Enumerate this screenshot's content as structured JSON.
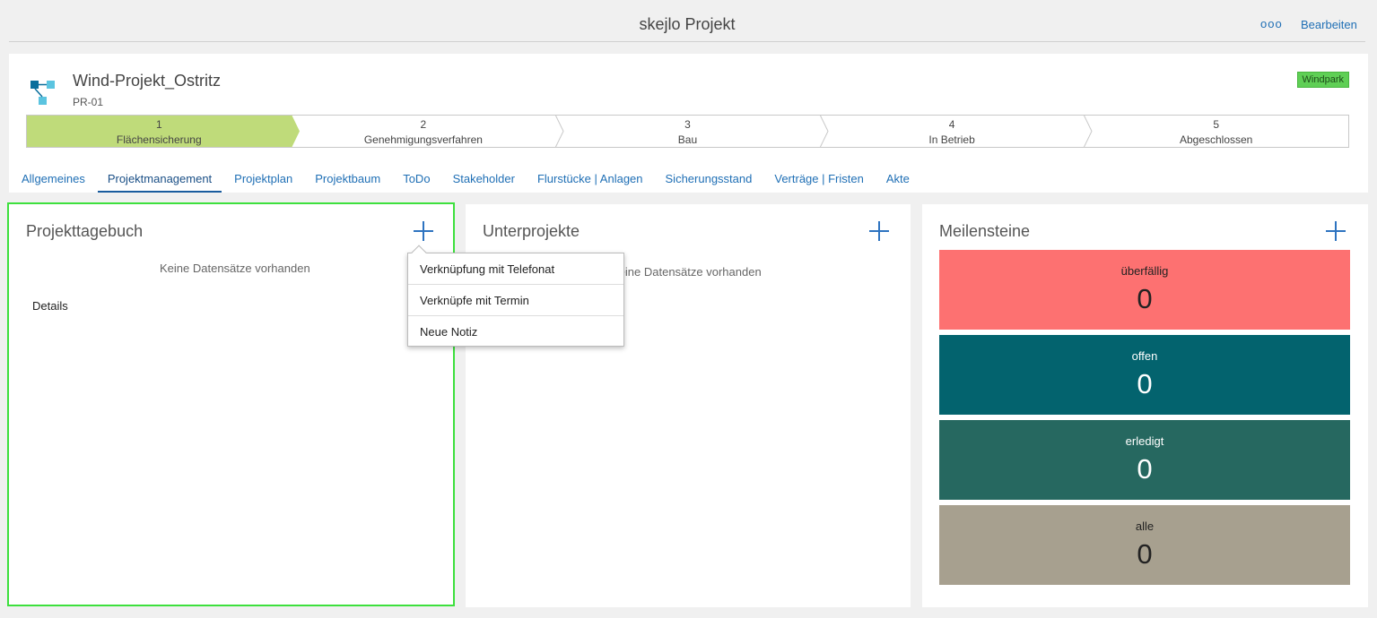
{
  "topbar": {
    "title": "skejlo Projekt",
    "more_label": "ooo",
    "edit_label": "Bearbeiten"
  },
  "project": {
    "name": "Wind-Projekt_Ostritz",
    "code": "PR-01",
    "badge": "Windpark"
  },
  "stages": [
    {
      "num": "1",
      "label": "Flächensicherung",
      "active": true
    },
    {
      "num": "2",
      "label": "Genehmigungsverfahren",
      "active": false
    },
    {
      "num": "3",
      "label": "Bau",
      "active": false
    },
    {
      "num": "4",
      "label": "In Betrieb",
      "active": false
    },
    {
      "num": "5",
      "label": "Abgeschlossen",
      "active": false
    }
  ],
  "tabs": [
    {
      "label": "Allgemeines"
    },
    {
      "label": "Projektmanagement",
      "active": true
    },
    {
      "label": "Projektplan"
    },
    {
      "label": "Projektbaum"
    },
    {
      "label": "ToDo"
    },
    {
      "label": "Stakeholder"
    },
    {
      "label": "Flurstücke | Anlagen"
    },
    {
      "label": "Sicherungsstand"
    },
    {
      "label": "Verträge | Fristen"
    },
    {
      "label": "Akte"
    }
  ],
  "panels": {
    "tagebuch": {
      "title": "Projekttagebuch",
      "empty": "Keine Datensätze vorhanden",
      "details": "Details"
    },
    "unterprojekte": {
      "title": "Unterprojekte",
      "empty": "Keine Datensätze vorhanden"
    },
    "meilensteine": {
      "title": "Meilensteine",
      "items": [
        {
          "label": "überfällig",
          "value": "0",
          "color": "#fd7171"
        },
        {
          "label": "offen",
          "value": "0",
          "color": "#03636e"
        },
        {
          "label": "erledigt",
          "value": "0",
          "color": "#266860"
        },
        {
          "label": "alle",
          "value": "0",
          "color": "#a7a08f"
        }
      ]
    }
  },
  "dropdown": {
    "items": [
      {
        "label": "Verknüpfung mit Telefonat"
      },
      {
        "label": "Verknüpfe mit Termin"
      },
      {
        "label": "Neue Notiz"
      }
    ]
  },
  "colors": {
    "accent": "#1f6fb5",
    "stage_active": "#bfdb7a",
    "selected_border": "#3de03d",
    "badge": "#5fcf55"
  }
}
